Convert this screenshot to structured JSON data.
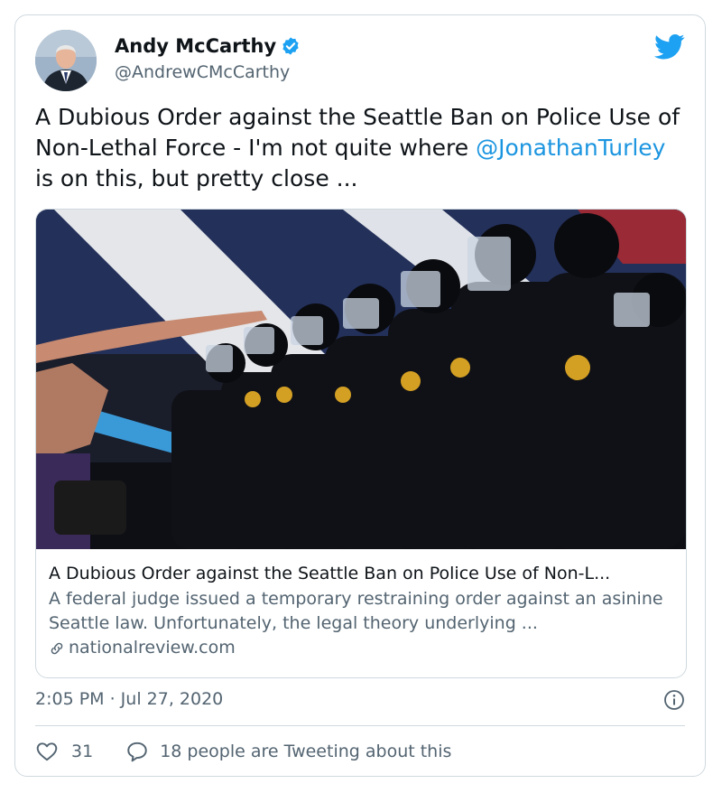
{
  "author": {
    "name": "Andy McCarthy",
    "handle": "@AndrewCMcCarthy",
    "verified": true
  },
  "tweet": {
    "text_before": "A Dubious Order against the Seattle Ban on Police Use of Non-Lethal Force - I'm not quite where ",
    "mention": "@JonathanTurley",
    "text_after": " is on this, but pretty close ..."
  },
  "link_card": {
    "title": "A Dubious Order against the Seattle Ban on Police Use of Non-L...",
    "description": "A federal judge issued a temporary restraining order against an asinine Seattle law. Unfortunately, the legal theory underlying ...",
    "domain": "nationalreview.com"
  },
  "meta": {
    "timestamp": "2:05 PM · Jul 27, 2020"
  },
  "actions": {
    "like_count": "31",
    "reply_label": "18 people are Tweeting about this"
  },
  "icons": {
    "verified": "verified-badge-icon",
    "brand": "twitter-bird-icon",
    "info": "info-icon",
    "like": "heart-icon",
    "reply": "speech-bubble-icon",
    "link": "link-icon"
  },
  "colors": {
    "brand": "#1da1f2",
    "mention": "#1b95e0",
    "secondary_text": "#536471",
    "border": "#cfd9de"
  }
}
